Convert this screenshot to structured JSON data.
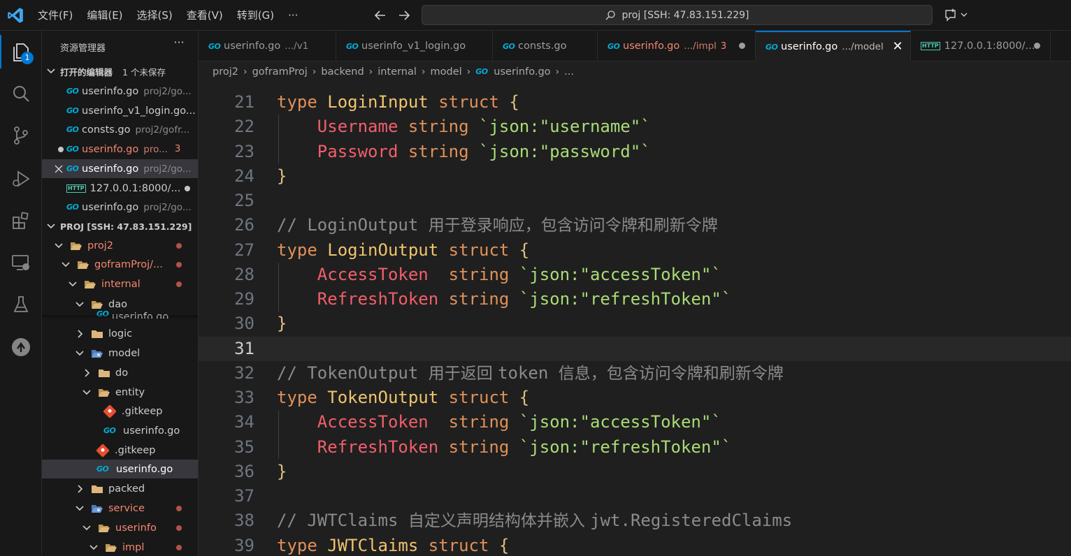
{
  "menubar": [
    "文件(F)",
    "编辑(E)",
    "选择(S)",
    "查看(V)",
    "转到(G)",
    "···"
  ],
  "command_center": {
    "text": "proj [SSH: 47.83.151.229]"
  },
  "activity": {
    "explorer_badge": "1"
  },
  "sidebar": {
    "title": "资源管理器",
    "more": "···",
    "open_editors": {
      "title": "打开的编辑器",
      "unsaved": "1 个未保存",
      "items": [
        {
          "icon": "GO",
          "name": "userinfo.go",
          "desc": "proj2/go..."
        },
        {
          "icon": "GO",
          "name": "userinfo_v1_login.go...",
          "desc": ""
        },
        {
          "icon": "GO",
          "name": "consts.go",
          "desc": "proj2/gofr..."
        },
        {
          "icon": "GO",
          "name": "userinfo.go",
          "desc": "pro...",
          "count": "3"
        },
        {
          "icon": "GO",
          "name": "userinfo.go",
          "desc": "proj2/go..."
        },
        {
          "icon": "HTTP",
          "name": "127.0.0.1:8000/...",
          "desc": ""
        },
        {
          "icon": "GO",
          "name": "userinfo.go",
          "desc": "proj2/go..."
        }
      ]
    },
    "workspace": {
      "title": "PROJ [SSH: 47.83.151.229]",
      "tree": [
        {
          "name": "proj2"
        },
        {
          "name": "goframProj/..."
        },
        {
          "name": "internal"
        },
        {
          "name": "dao"
        },
        {
          "name": "userinfo.go"
        },
        {
          "name": "logic"
        },
        {
          "name": "model"
        },
        {
          "name": "do"
        },
        {
          "name": "entity"
        },
        {
          "name": ".gitkeep"
        },
        {
          "name": "userinfo.go"
        },
        {
          "name": ".gitkeep"
        },
        {
          "name": "userinfo.go"
        },
        {
          "name": "packed"
        },
        {
          "name": "service"
        },
        {
          "name": "userinfo"
        },
        {
          "name": "impl"
        }
      ]
    }
  },
  "tabs": [
    {
      "name": "userinfo.go",
      "desc": ".../v1"
    },
    {
      "name": "userinfo_v1_login.go",
      "desc": ""
    },
    {
      "name": "consts.go",
      "desc": ""
    },
    {
      "name": "userinfo.go",
      "desc": ".../impl",
      "count": "3"
    },
    {
      "name": "userinfo.go",
      "desc": ".../model"
    },
    {
      "name": "127.0.0.1:8000/...",
      "desc": ""
    }
  ],
  "breadcrumb": [
    "proj2",
    "goframProj",
    "backend",
    "internal",
    "model",
    "userinfo.go",
    "..."
  ],
  "editor": {
    "lines": [
      {
        "n": "21",
        "parts": [
          [
            "kw",
            "type "
          ],
          [
            "ty",
            "LoginInput"
          ],
          [
            "kw",
            " struct"
          ],
          [
            "br",
            " {"
          ]
        ]
      },
      {
        "n": "22",
        "parts": [
          [
            "",
            "    "
          ],
          [
            "fld",
            "Username"
          ],
          [
            "kw",
            " string"
          ],
          [
            "str",
            " `json:\"username\"`"
          ]
        ]
      },
      {
        "n": "23",
        "parts": [
          [
            "",
            "    "
          ],
          [
            "fld",
            "Password"
          ],
          [
            "kw",
            " string"
          ],
          [
            "str",
            " `json:\"password\"`"
          ]
        ]
      },
      {
        "n": "24",
        "parts": [
          [
            "br",
            "}"
          ]
        ]
      },
      {
        "n": "25",
        "parts": []
      },
      {
        "n": "26",
        "parts": [
          [
            "cm",
            "// LoginOutput "
          ],
          [
            "cmcn",
            "用于登录响应，包含访问令牌和刷新令牌"
          ]
        ]
      },
      {
        "n": "27",
        "parts": [
          [
            "kw",
            "type "
          ],
          [
            "ty",
            "LoginOutput"
          ],
          [
            "kw",
            " struct"
          ],
          [
            "br",
            " {"
          ]
        ]
      },
      {
        "n": "28",
        "parts": [
          [
            "",
            "    "
          ],
          [
            "fld",
            "AccessToken"
          ],
          [
            "kw",
            "  string"
          ],
          [
            "str",
            " `json:\"accessToken\"`"
          ]
        ]
      },
      {
        "n": "29",
        "parts": [
          [
            "",
            "    "
          ],
          [
            "fld",
            "RefreshToken"
          ],
          [
            "kw",
            " string"
          ],
          [
            "str",
            " `json:\"refreshToken\"`"
          ]
        ]
      },
      {
        "n": "30",
        "parts": [
          [
            "br",
            "}"
          ]
        ]
      },
      {
        "n": "31",
        "parts": []
      },
      {
        "n": "32",
        "parts": [
          [
            "cm",
            "// TokenOutput "
          ],
          [
            "cmcn",
            "用于返回 "
          ],
          [
            "cm",
            "token "
          ],
          [
            "cmcn",
            "信息，包含访问令牌和刷新令牌"
          ]
        ]
      },
      {
        "n": "33",
        "parts": [
          [
            "kw",
            "type "
          ],
          [
            "ty",
            "TokenOutput"
          ],
          [
            "kw",
            " struct"
          ],
          [
            "br",
            " {"
          ]
        ]
      },
      {
        "n": "34",
        "parts": [
          [
            "",
            "    "
          ],
          [
            "fld",
            "AccessToken"
          ],
          [
            "kw",
            "  string"
          ],
          [
            "str",
            " `json:\"accessToken\"`"
          ]
        ]
      },
      {
        "n": "35",
        "parts": [
          [
            "",
            "    "
          ],
          [
            "fld",
            "RefreshToken"
          ],
          [
            "kw",
            " string"
          ],
          [
            "str",
            " `json:\"refreshToken\"`"
          ]
        ]
      },
      {
        "n": "36",
        "parts": [
          [
            "br",
            "}"
          ]
        ]
      },
      {
        "n": "37",
        "parts": []
      },
      {
        "n": "38",
        "parts": [
          [
            "cm",
            "// JWTClaims "
          ],
          [
            "cmcn",
            "自定义声明结构体并嵌入 "
          ],
          [
            "cm",
            "jwt.RegisteredClaims"
          ]
        ]
      },
      {
        "n": "39",
        "parts": [
          [
            "kw",
            "type "
          ],
          [
            "ty",
            "JWTClaims"
          ],
          [
            "kw",
            " struct"
          ],
          [
            "br",
            " {"
          ]
        ]
      }
    ],
    "current_line": "31"
  },
  "colors": {
    "accent": "#0078d4",
    "keyword": "#e0915a",
    "type": "#f0c36e",
    "field": "#f05f6b",
    "string": "#a9dc76",
    "comment": "#8b8b8b"
  }
}
